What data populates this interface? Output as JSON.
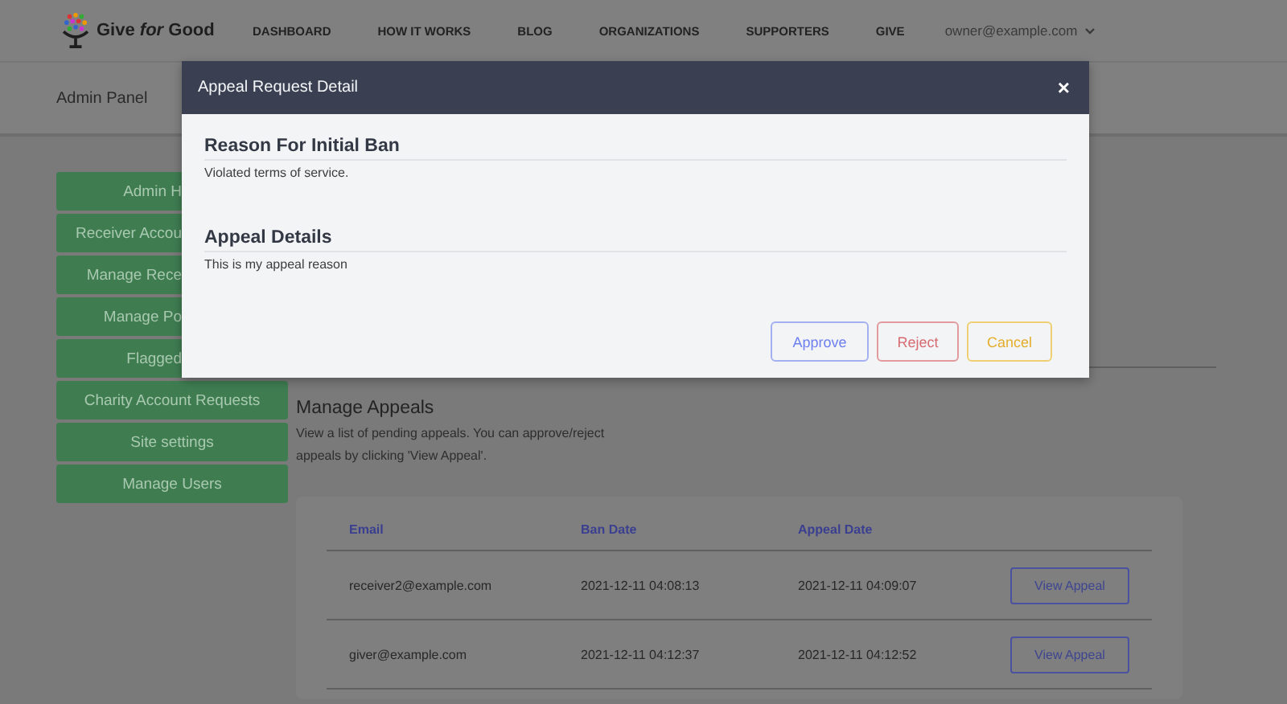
{
  "navbar": {
    "brand": "Give *for* Good",
    "links": [
      "DASHBOARD",
      "HOW IT WORKS",
      "BLOG",
      "ORGANIZATIONS",
      "SUPPORTERS",
      "GIVE"
    ],
    "account": "owner@example.com"
  },
  "page_header": {
    "title": "Admin Panel"
  },
  "sidebar": {
    "items": [
      {
        "label": "Admin H",
        "covered": true
      },
      {
        "label": "Receiver Accou",
        "covered": true
      },
      {
        "label": "Manage Rece",
        "covered": true
      },
      {
        "label": "Manage Po",
        "covered": true
      },
      {
        "label": "Flagged",
        "covered": true
      },
      {
        "label": "Charity Account Requests",
        "covered": false
      },
      {
        "label": "Site settings",
        "covered": false
      },
      {
        "label": "Manage Users",
        "covered": false
      }
    ]
  },
  "appeals": {
    "title": "Manage Appeals",
    "description": "View a list of pending appeals. You can approve/reject appeals by clicking 'View Appeal'.",
    "columns": [
      "Email",
      "Ban Date",
      "Appeal Date"
    ],
    "rows": [
      {
        "email": "receiver2@example.com",
        "ban_date": "2021-12-11 04:08:13",
        "appeal_date": "2021-12-11 04:09:07",
        "action": "View Appeal"
      },
      {
        "email": "giver@example.com",
        "ban_date": "2021-12-11 04:12:37",
        "appeal_date": "2021-12-11 04:12:52",
        "action": "View Appeal"
      }
    ]
  },
  "dialog": {
    "title": "Appeal Request Detail",
    "close": "×",
    "sections": [
      {
        "heading": "Reason For Initial Ban",
        "text": "Violated terms of service."
      },
      {
        "heading": "Appeal Details",
        "text": "This is my appeal reason"
      }
    ],
    "buttons": [
      {
        "label": "Approve",
        "kind": "approve"
      },
      {
        "label": "Reject",
        "kind": "reject"
      },
      {
        "label": "Cancel",
        "kind": "cancel"
      }
    ]
  }
}
